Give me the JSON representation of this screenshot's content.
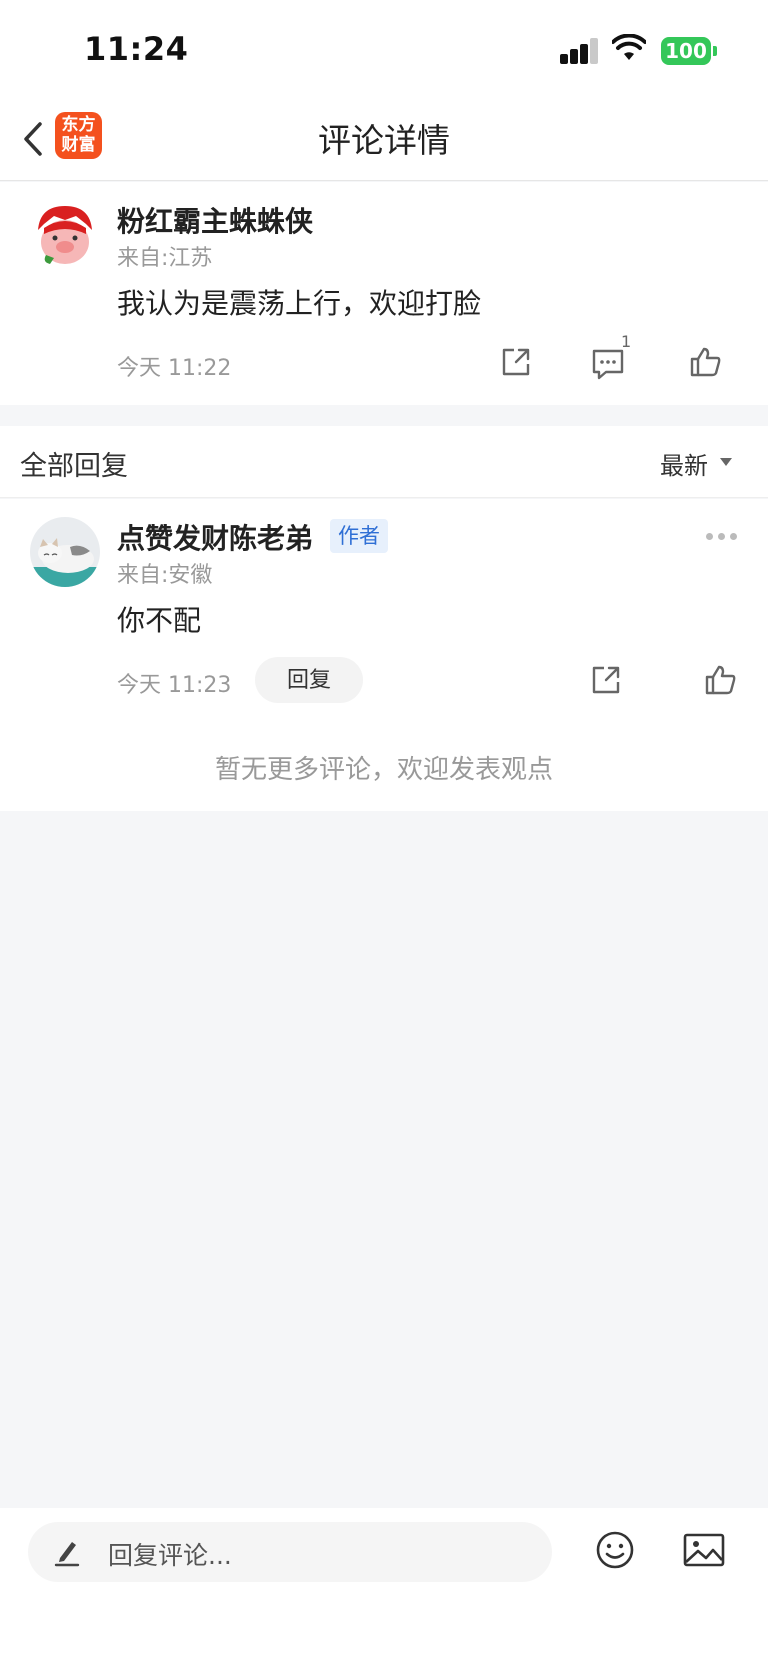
{
  "status_bar": {
    "time": "11:24",
    "battery": "100"
  },
  "nav": {
    "title": "评论详情",
    "logo_line1": "东方",
    "logo_line2": "财富"
  },
  "comment": {
    "username": "粉红霸主蛛蛛侠",
    "location": "来自:江苏",
    "text": "我认为是震荡上行，欢迎打脸",
    "time": "今天 11:22",
    "reply_count": "1"
  },
  "replies_section": {
    "title": "全部回复",
    "sort_label": "最新"
  },
  "reply": {
    "username": "点赞发财陈老弟",
    "badge": "作者",
    "location": "来自:安徽",
    "text": "你不配",
    "time": "今天 11:23",
    "reply_button": "回复"
  },
  "footer_note": "暂无更多评论，欢迎发表观点",
  "bottom_bar": {
    "placeholder": "回复评论..."
  },
  "colors": {
    "brand": "#f4511e",
    "battery": "#34c759",
    "badge_text": "#2f6fd5",
    "badge_bg": "#e7f0fc"
  }
}
